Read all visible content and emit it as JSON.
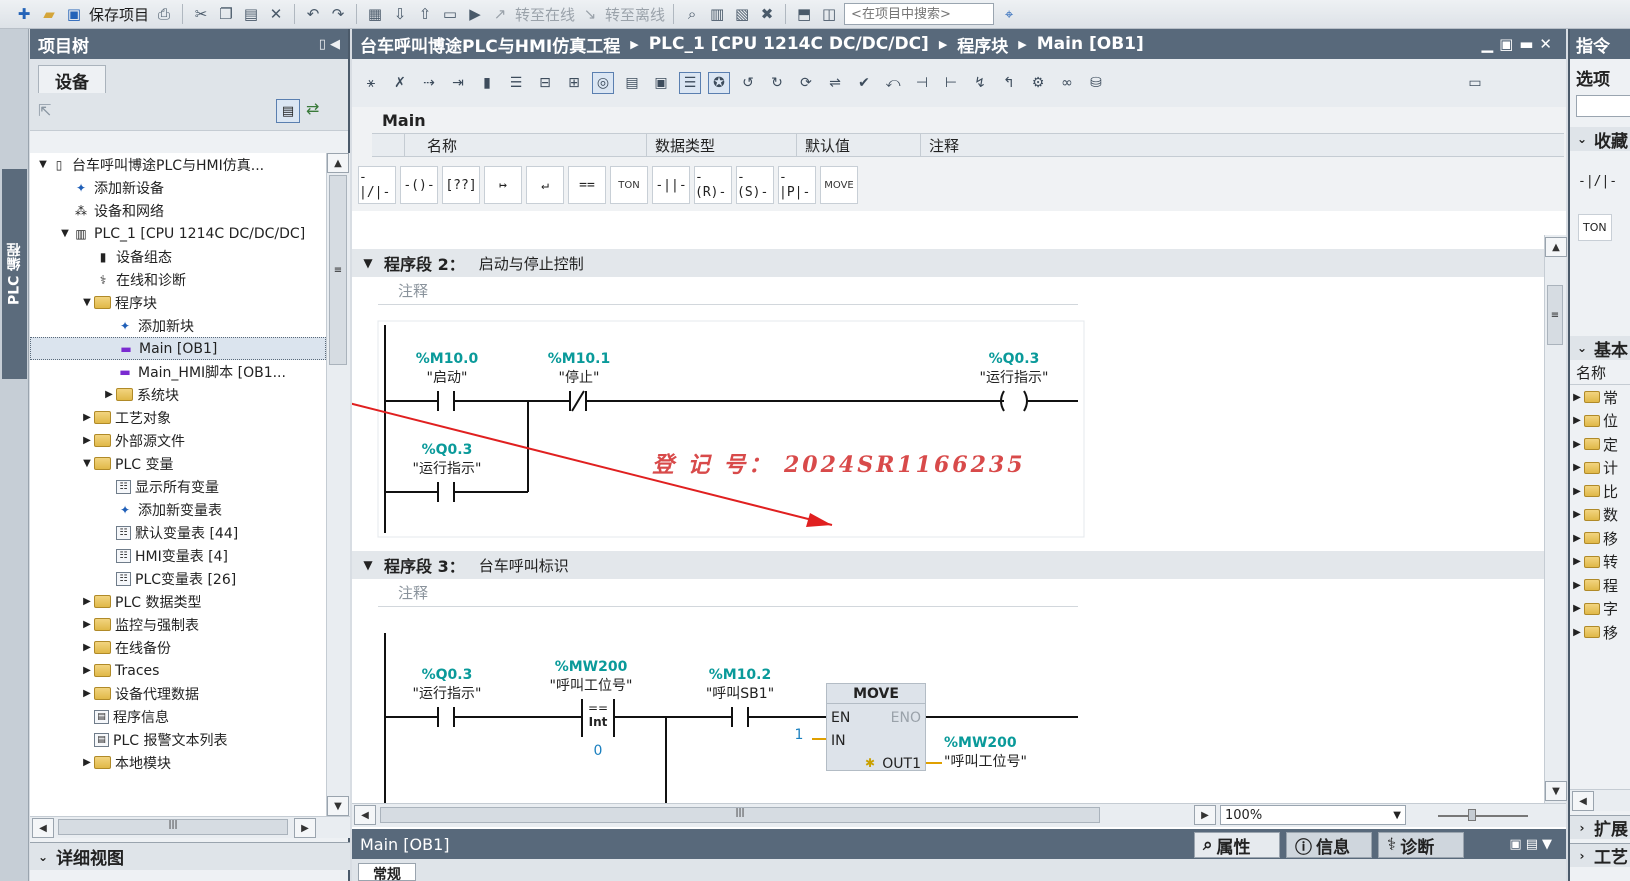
{
  "toolbar": {
    "save_project": "保存项目",
    "go_online": "转至在线",
    "go_offline": "转至离线",
    "search_placeholder": "<在项目中搜索>"
  },
  "left_vertical_tab": "PLC 编程",
  "project_tree": {
    "title": "项目树",
    "tab_devices": "设备",
    "items": [
      {
        "label": "台车呼叫博途PLC与HMI仿真...",
        "level": 0,
        "arrow": "▼",
        "icon": "project-icon"
      },
      {
        "label": "添加新设备",
        "level": 1,
        "arrow": "",
        "icon": "add-device-icon"
      },
      {
        "label": "设备和网络",
        "level": 1,
        "arrow": "",
        "icon": "network-icon"
      },
      {
        "label": "PLC_1 [CPU 1214C DC/DC/DC]",
        "level": 1,
        "arrow": "▼",
        "icon": "plc-icon"
      },
      {
        "label": "设备组态",
        "level": 2,
        "arrow": "",
        "icon": "device-config-icon"
      },
      {
        "label": "在线和诊断",
        "level": 2,
        "arrow": "",
        "icon": "online-diag-icon"
      },
      {
        "label": "程序块",
        "level": 2,
        "arrow": "▼",
        "icon": "folder-icon"
      },
      {
        "label": "添加新块",
        "level": 3,
        "arrow": "",
        "icon": "add-block-icon"
      },
      {
        "label": "Main [OB1]",
        "level": 3,
        "arrow": "",
        "icon": "block-icon",
        "selected": true
      },
      {
        "label": "Main_HMI脚本 [OB1...",
        "level": 3,
        "arrow": "",
        "icon": "block-icon"
      },
      {
        "label": "系统块",
        "level": 3,
        "arrow": "▶",
        "icon": "folder-icon"
      },
      {
        "label": "工艺对象",
        "level": 2,
        "arrow": "▶",
        "icon": "folder-icon"
      },
      {
        "label": "外部源文件",
        "level": 2,
        "arrow": "▶",
        "icon": "folder-icon"
      },
      {
        "label": "PLC 变量",
        "level": 2,
        "arrow": "▼",
        "icon": "folder-icon"
      },
      {
        "label": "显示所有变量",
        "level": 3,
        "arrow": "",
        "icon": "tag-table-icon"
      },
      {
        "label": "添加新变量表",
        "level": 3,
        "arrow": "",
        "icon": "add-tag-table-icon"
      },
      {
        "label": "默认变量表 [44]",
        "level": 3,
        "arrow": "",
        "icon": "tag-table-icon"
      },
      {
        "label": "HMI变量表 [4]",
        "level": 3,
        "arrow": "",
        "icon": "tag-table-icon"
      },
      {
        "label": "PLC变量表 [26]",
        "level": 3,
        "arrow": "",
        "icon": "tag-table-icon"
      },
      {
        "label": "PLC 数据类型",
        "level": 2,
        "arrow": "▶",
        "icon": "folder-icon"
      },
      {
        "label": "监控与强制表",
        "level": 2,
        "arrow": "▶",
        "icon": "folder-icon"
      },
      {
        "label": "在线备份",
        "level": 2,
        "arrow": "▶",
        "icon": "folder-icon"
      },
      {
        "label": "Traces",
        "level": 2,
        "arrow": "▶",
        "icon": "folder-icon"
      },
      {
        "label": "设备代理数据",
        "level": 2,
        "arrow": "▶",
        "icon": "folder-icon"
      },
      {
        "label": "程序信息",
        "level": 2,
        "arrow": "",
        "icon": "program-info-icon"
      },
      {
        "label": "PLC 报警文本列表",
        "level": 2,
        "arrow": "",
        "icon": "alarm-text-icon"
      },
      {
        "label": "本地模块",
        "level": 2,
        "arrow": "▶",
        "icon": "folder-icon"
      }
    ],
    "detail_view": "详细视图"
  },
  "editor": {
    "breadcrumb": [
      "台车呼叫博途PLC与HMI仿真工程",
      "PLC_1 [CPU 1214C DC/DC/DC]",
      "程序块",
      "Main [OB1]"
    ],
    "interface_name": "Main",
    "columns": [
      "名称",
      "数据类型",
      "默认值",
      "注释"
    ],
    "ladder_toolbar": [
      "-|/|-",
      "-()-",
      "[??]",
      "↦",
      "↵",
      "==",
      "TON",
      "-||-",
      "-(R)-",
      "-(S)-",
      "-|P|-",
      "MOVE"
    ],
    "networks": [
      {
        "label": "程序段 2：",
        "title": "启动与停止控制",
        "comment": "注释",
        "contacts": [
          {
            "addr": "%M10.0",
            "name": "\"启动\""
          },
          {
            "addr": "%M10.1",
            "name": "\"停止\""
          },
          {
            "addr": "%Q0.3",
            "name": "\"运行指示\""
          }
        ],
        "coil": {
          "addr": "%Q0.3",
          "name": "\"运行指示\""
        }
      },
      {
        "label": "程序段 3：",
        "title": "台车呼叫标识",
        "comment": "注释",
        "contacts": [
          {
            "addr": "%Q0.3",
            "name": "\"运行指示\""
          },
          {
            "addr": "%MW200",
            "name": "\"呼叫工位号\""
          },
          {
            "addr": "%M10.2",
            "name": "\"呼叫SB1\""
          }
        ],
        "compare": {
          "op": "==",
          "type": "Int",
          "value": "0"
        },
        "move": {
          "title": "MOVE",
          "en": "EN",
          "eno": "ENO",
          "in": "IN",
          "out": "OUT1",
          "in_value": "1",
          "out_addr": "%MW200",
          "out_name": "\"呼叫工位号\""
        }
      }
    ],
    "watermark": "登 记 号： 2024SR1166235",
    "zoom": "100%",
    "properties_title": "Main [OB1]",
    "properties_tabs": [
      "属性",
      "信息",
      "诊断"
    ],
    "properties_sub_tab": "常规"
  },
  "right_panel": {
    "title": "指令",
    "options": "选项",
    "favorites": "收藏",
    "fav_items": [
      "-|/|-",
      "TON"
    ],
    "basic": "基本",
    "name_col": "名称",
    "items": [
      "常",
      "位",
      "定",
      "计",
      "比",
      "数",
      "移",
      "转",
      "程",
      "字",
      "移"
    ],
    "expand": "扩展",
    "tech": "工艺"
  }
}
